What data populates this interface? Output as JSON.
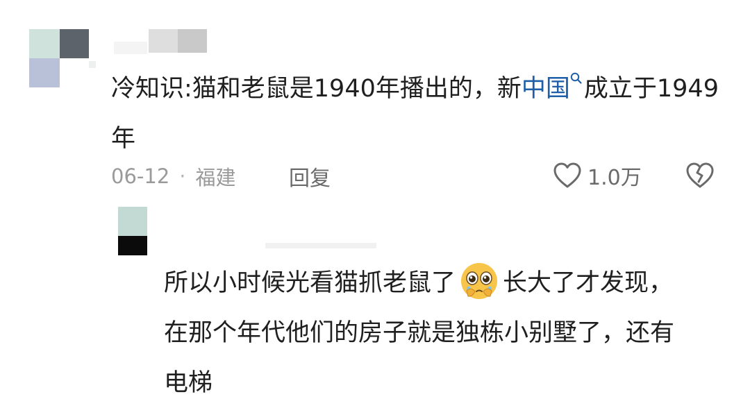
{
  "comment": {
    "text_before_link": "冷知识:猫和老鼠是1940年播出的，新",
    "link_text": "中国",
    "text_after_link": "成立于1949年",
    "date": "06-12",
    "separator": "·",
    "location": "福建",
    "reply_label": "回复",
    "like_count": "1.0万",
    "icons": [
      "search-icon",
      "heart-icon",
      "broken-heart-icon"
    ]
  },
  "reply": {
    "text_before_emoji": "所以小时候光看猫抓老鼠了",
    "emoji": "pleading-face-emoji",
    "text_after_emoji": "长大了才发现，在那个年代他们的房子就是独栋小别墅了，还有电梯"
  },
  "colors": {
    "text": "#1f1f1f",
    "link": "#1f5fa8",
    "meta": "#9a9a9a",
    "icon": "#6a6a6a"
  }
}
